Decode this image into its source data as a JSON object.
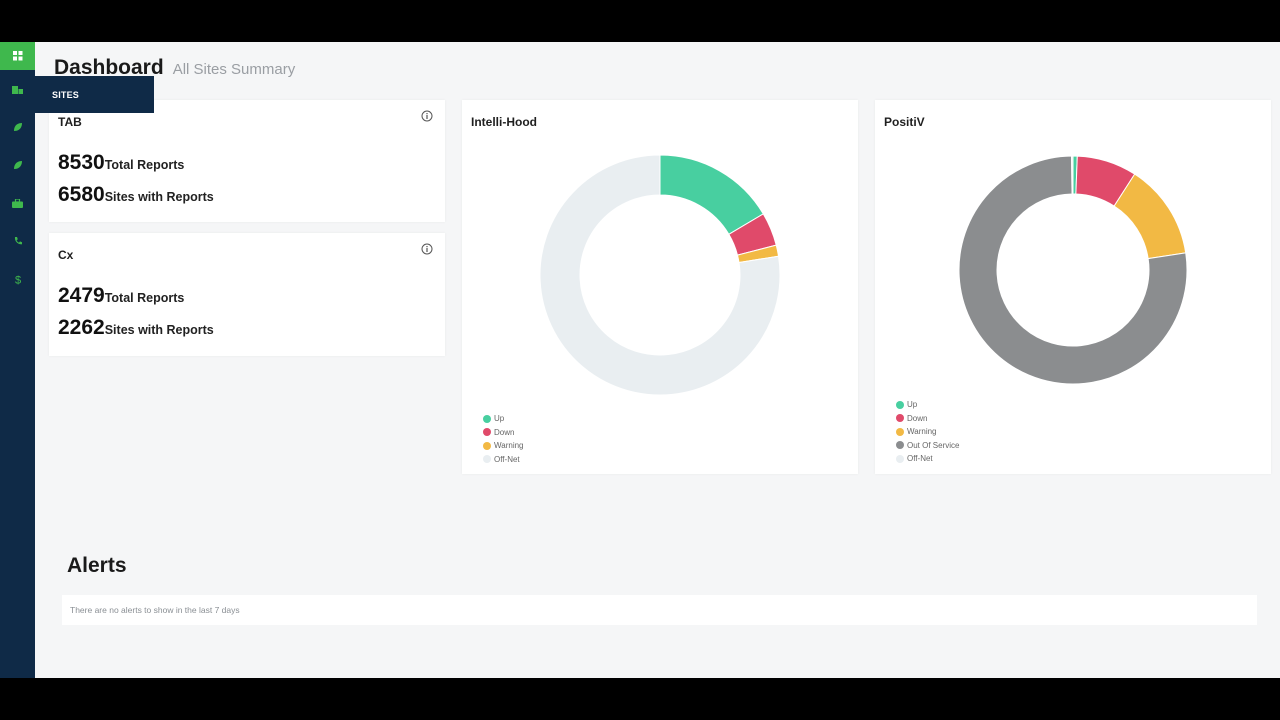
{
  "page": {
    "title": "Dashboard",
    "subtitle": "All Sites Summary"
  },
  "sidebar": {
    "top_icon": "dashboard-grid-icon",
    "items": [
      {
        "icon": "sites-icon"
      },
      {
        "icon": "leaf-icon"
      },
      {
        "icon": "leaf-icon"
      },
      {
        "icon": "toolbox-icon"
      },
      {
        "icon": "phone-icon"
      },
      {
        "icon": "dollar-icon"
      }
    ],
    "flyout_label": "SITES"
  },
  "cards": [
    {
      "title": "TAB",
      "stats": [
        {
          "value": "8530",
          "label": "Total Reports"
        },
        {
          "value": "6580",
          "label": "Sites with Reports"
        }
      ]
    },
    {
      "title": "Cx",
      "stats": [
        {
          "value": "2479",
          "label": "Total Reports"
        },
        {
          "value": "2262",
          "label": "Sites with Reports"
        }
      ]
    }
  ],
  "chart_data": [
    {
      "type": "pie",
      "title": "Intelli-Hood",
      "categories": [
        "Up",
        "Down",
        "Warning",
        "Off-Net"
      ],
      "values": [
        16.5,
        4.5,
        1.5,
        77.5
      ],
      "colors": [
        "#48cfa0",
        "#e04a6a",
        "#f2b944",
        "#e9eef1"
      ],
      "legend": "bottom-left"
    },
    {
      "type": "pie",
      "title": "PositiV",
      "categories": [
        "Up",
        "Down",
        "Warning",
        "Out Of Service",
        "Off-Net"
      ],
      "values": [
        0.6,
        8.5,
        13.5,
        77.2,
        0.2
      ],
      "colors": [
        "#48cfa0",
        "#e04a6a",
        "#f2b944",
        "#8b8d8f",
        "#e9eef1"
      ],
      "legend": "bottom-left"
    }
  ],
  "alerts": {
    "title": "Alerts",
    "empty_message": "There are no alerts to show in the last 7 days"
  }
}
